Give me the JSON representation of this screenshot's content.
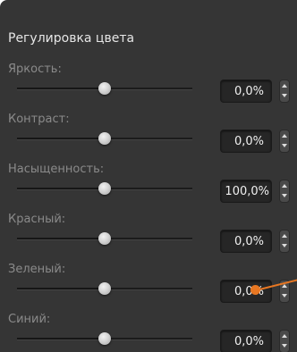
{
  "panel": {
    "title": "Регулировка цвета"
  },
  "rows": [
    {
      "label": "Яркость:",
      "value": "0,0%",
      "slider_position": 0.5
    },
    {
      "label": "Контраст:",
      "value": "0,0%",
      "slider_position": 0.5
    },
    {
      "label": "Насыщенность:",
      "value": "100,0%",
      "slider_position": 0.5
    },
    {
      "label": "Красный:",
      "value": "0,0%",
      "slider_position": 0.5
    },
    {
      "label": "Зеленый:",
      "value": "0,0%",
      "slider_position": 0.5
    },
    {
      "label": "Синий:",
      "value": "0,0%",
      "slider_position": 0.5
    }
  ],
  "icons": {
    "stepper": "up-down-stepper-icon"
  },
  "colors": {
    "panel_bg": "#353535",
    "callout_accent": "#e87722"
  }
}
